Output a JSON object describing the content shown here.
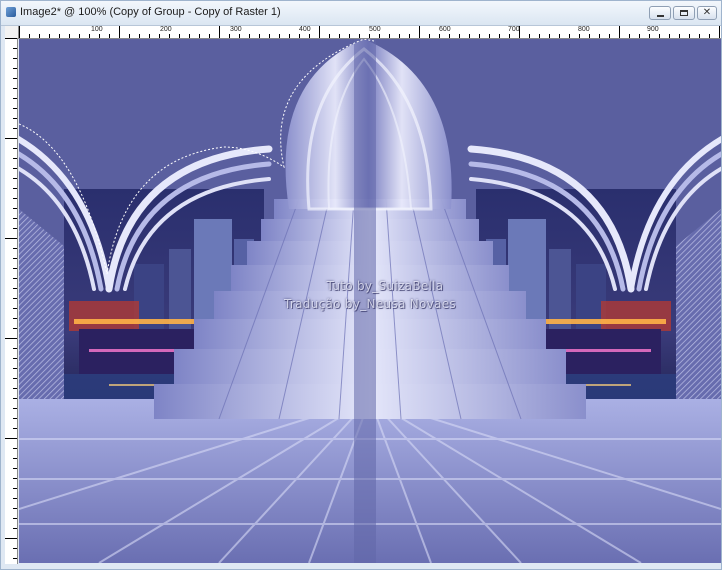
{
  "window": {
    "title": "Image2* @ 100% (Copy of Group - Copy of Raster 1)",
    "controls": {
      "minimize": "minimize",
      "maximize": "maximize",
      "close": "close"
    }
  },
  "ruler": {
    "top_labels": [
      "100",
      "200",
      "300",
      "400",
      "500",
      "600",
      "700",
      "800",
      "900"
    ]
  },
  "canvas": {
    "watermark_line1": "Tuto by_SuizaBella",
    "watermark_line2": "Tradução by_Neusa Novaes",
    "colors": {
      "background": "#5a5f9f",
      "light": "#dfe1f7",
      "mid": "#8b8fc9",
      "city_glow": "#ffb347"
    }
  }
}
